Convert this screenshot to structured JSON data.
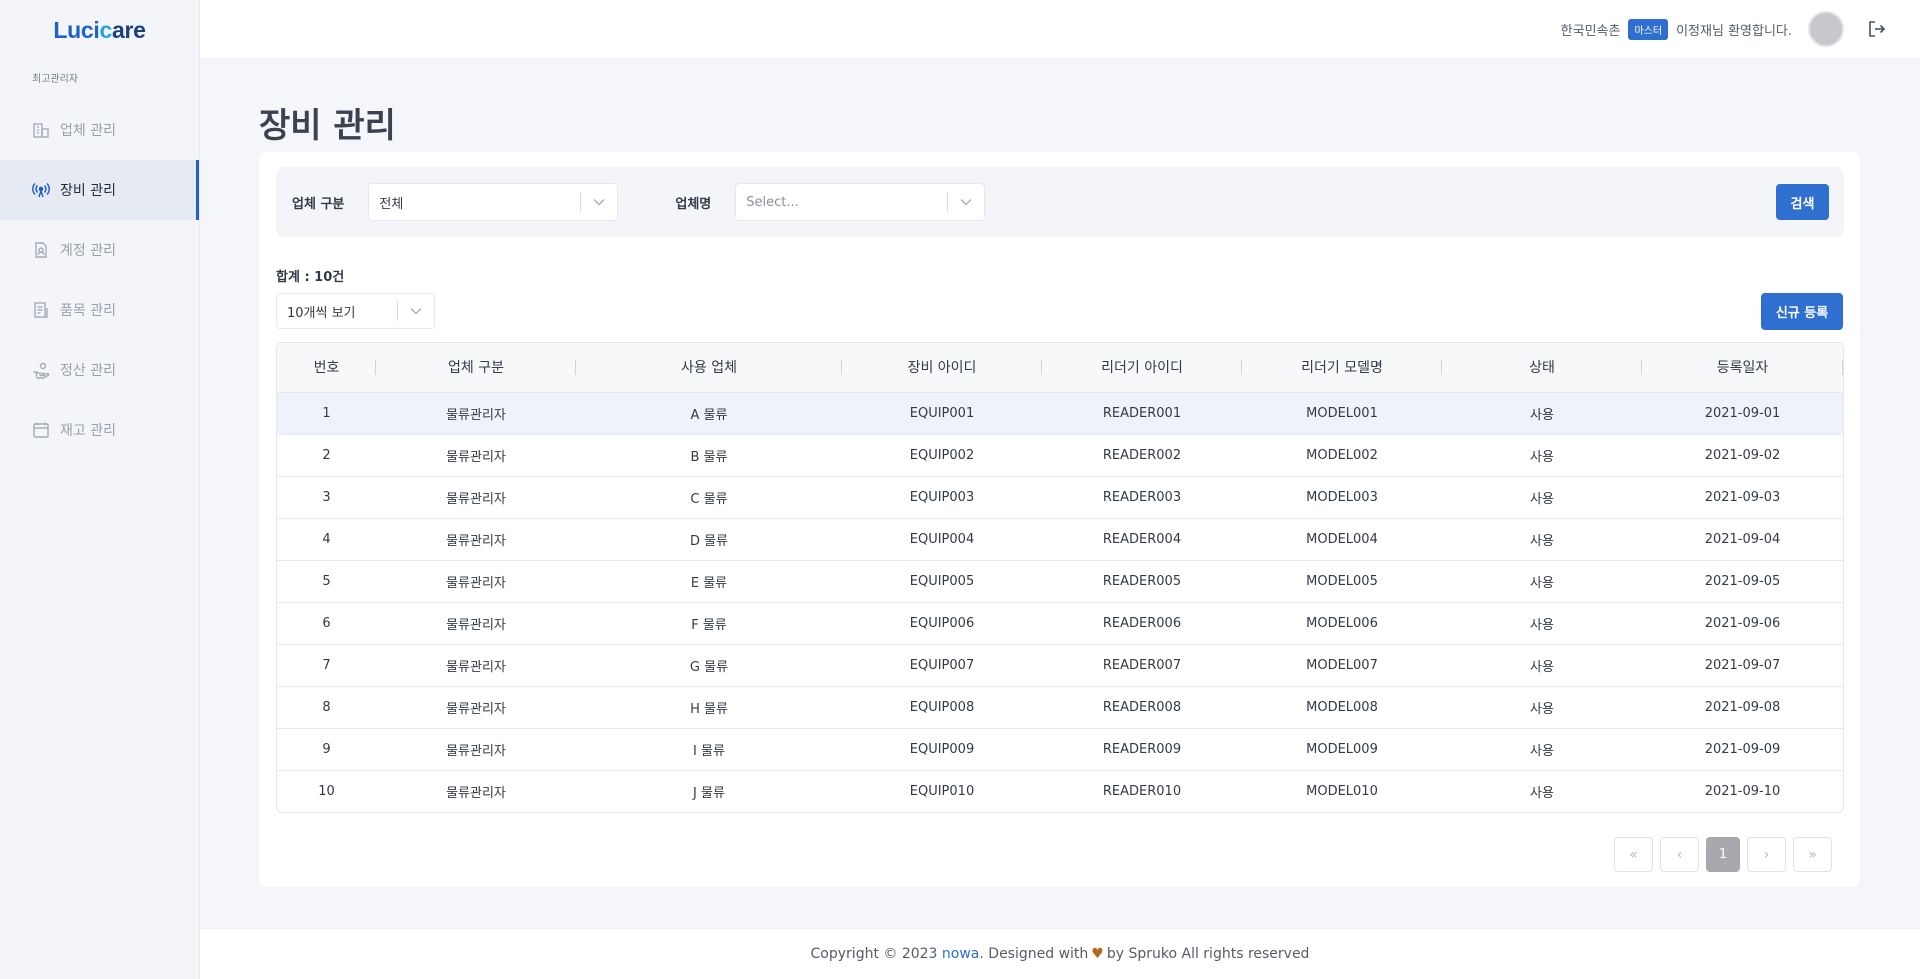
{
  "brand": {
    "part1": "Luci",
    "part2": "c",
    "part3": "are"
  },
  "sidebar": {
    "role": "최고관리자",
    "items": [
      {
        "label": "업체 관리",
        "icon": "building-icon",
        "active": false
      },
      {
        "label": "장비 관리",
        "icon": "antenna-icon",
        "active": true
      },
      {
        "label": "계정 관리",
        "icon": "account-icon",
        "active": false
      },
      {
        "label": "품목 관리",
        "icon": "document-icon",
        "active": false
      },
      {
        "label": "정산 관리",
        "icon": "settlement-icon",
        "active": false
      },
      {
        "label": "재고 관리",
        "icon": "inventory-icon",
        "active": false
      }
    ]
  },
  "header": {
    "org": "한국민속촌",
    "badge": "마스터",
    "welcome": "이정재님 환영합니다."
  },
  "page": {
    "title": "장비 관리"
  },
  "filter": {
    "type_label": "업체 구분",
    "type_value": "전체",
    "name_label": "업체명",
    "name_placeholder": "Select...",
    "search_label": "검색"
  },
  "list": {
    "total": "합계 : 10건",
    "per_page": "10개씩 보기",
    "new_label": "신규 등록"
  },
  "table": {
    "headers": [
      "번호",
      "업체 구분",
      "사용 업체",
      "장비 아이디",
      "리더기 아이디",
      "리더기 모델명",
      "상태",
      "등록일자"
    ],
    "rows": [
      [
        "1",
        "물류관리자",
        "A 물류",
        "EQUIP001",
        "READER001",
        "MODEL001",
        "사용",
        "2021-09-01"
      ],
      [
        "2",
        "물류관리자",
        "B 물류",
        "EQUIP002",
        "READER002",
        "MODEL002",
        "사용",
        "2021-09-02"
      ],
      [
        "3",
        "물류관리자",
        "C 물류",
        "EQUIP003",
        "READER003",
        "MODEL003",
        "사용",
        "2021-09-03"
      ],
      [
        "4",
        "물류관리자",
        "D 물류",
        "EQUIP004",
        "READER004",
        "MODEL004",
        "사용",
        "2021-09-04"
      ],
      [
        "5",
        "물류관리자",
        "E 물류",
        "EQUIP005",
        "READER005",
        "MODEL005",
        "사용",
        "2021-09-05"
      ],
      [
        "6",
        "물류관리자",
        "F 물류",
        "EQUIP006",
        "READER006",
        "MODEL006",
        "사용",
        "2021-09-06"
      ],
      [
        "7",
        "물류관리자",
        "G 물류",
        "EQUIP007",
        "READER007",
        "MODEL007",
        "사용",
        "2021-09-07"
      ],
      [
        "8",
        "물류관리자",
        "H 물류",
        "EQUIP008",
        "READER008",
        "MODEL008",
        "사용",
        "2021-09-08"
      ],
      [
        "9",
        "물류관리자",
        "I 물류",
        "EQUIP009",
        "READER009",
        "MODEL009",
        "사용",
        "2021-09-09"
      ],
      [
        "10",
        "물류관리자",
        "J 물류",
        "EQUIP010",
        "READER010",
        "MODEL010",
        "사용",
        "2021-09-10"
      ]
    ]
  },
  "pagination": {
    "first": "«",
    "prev": "‹",
    "current": "1",
    "next": "›",
    "last": "»"
  },
  "footer": {
    "prefix": "Copyright © 2023 ",
    "link": "nowa",
    "middle": ". Designed with",
    "heart": "♥",
    "suffix": "by Spruko All rights reserved"
  },
  "colors": {
    "primary": "#2f6fcf",
    "sidebar_active_bar": "#2260c9",
    "heart": "#b7681e"
  }
}
